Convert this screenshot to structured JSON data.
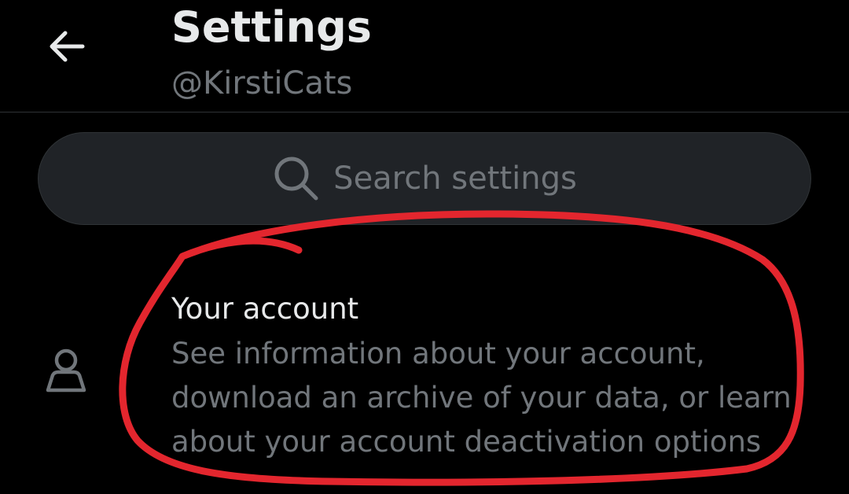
{
  "header": {
    "title": "Settings",
    "handle": "@KirstiCats",
    "back_icon": "arrow-left-icon"
  },
  "search": {
    "placeholder": "Search settings",
    "icon": "search-icon"
  },
  "settings_items": [
    {
      "icon": "person-icon",
      "title": "Your account",
      "description": "See information about your account, download an archive of your data, or learn about your account deactivation options"
    }
  ],
  "colors": {
    "background": "#000000",
    "primary_text": "#e7e9ea",
    "secondary_text": "#71767b",
    "search_bg": "#202327",
    "divider": "#2f3336",
    "annotation": "#e3262e"
  }
}
